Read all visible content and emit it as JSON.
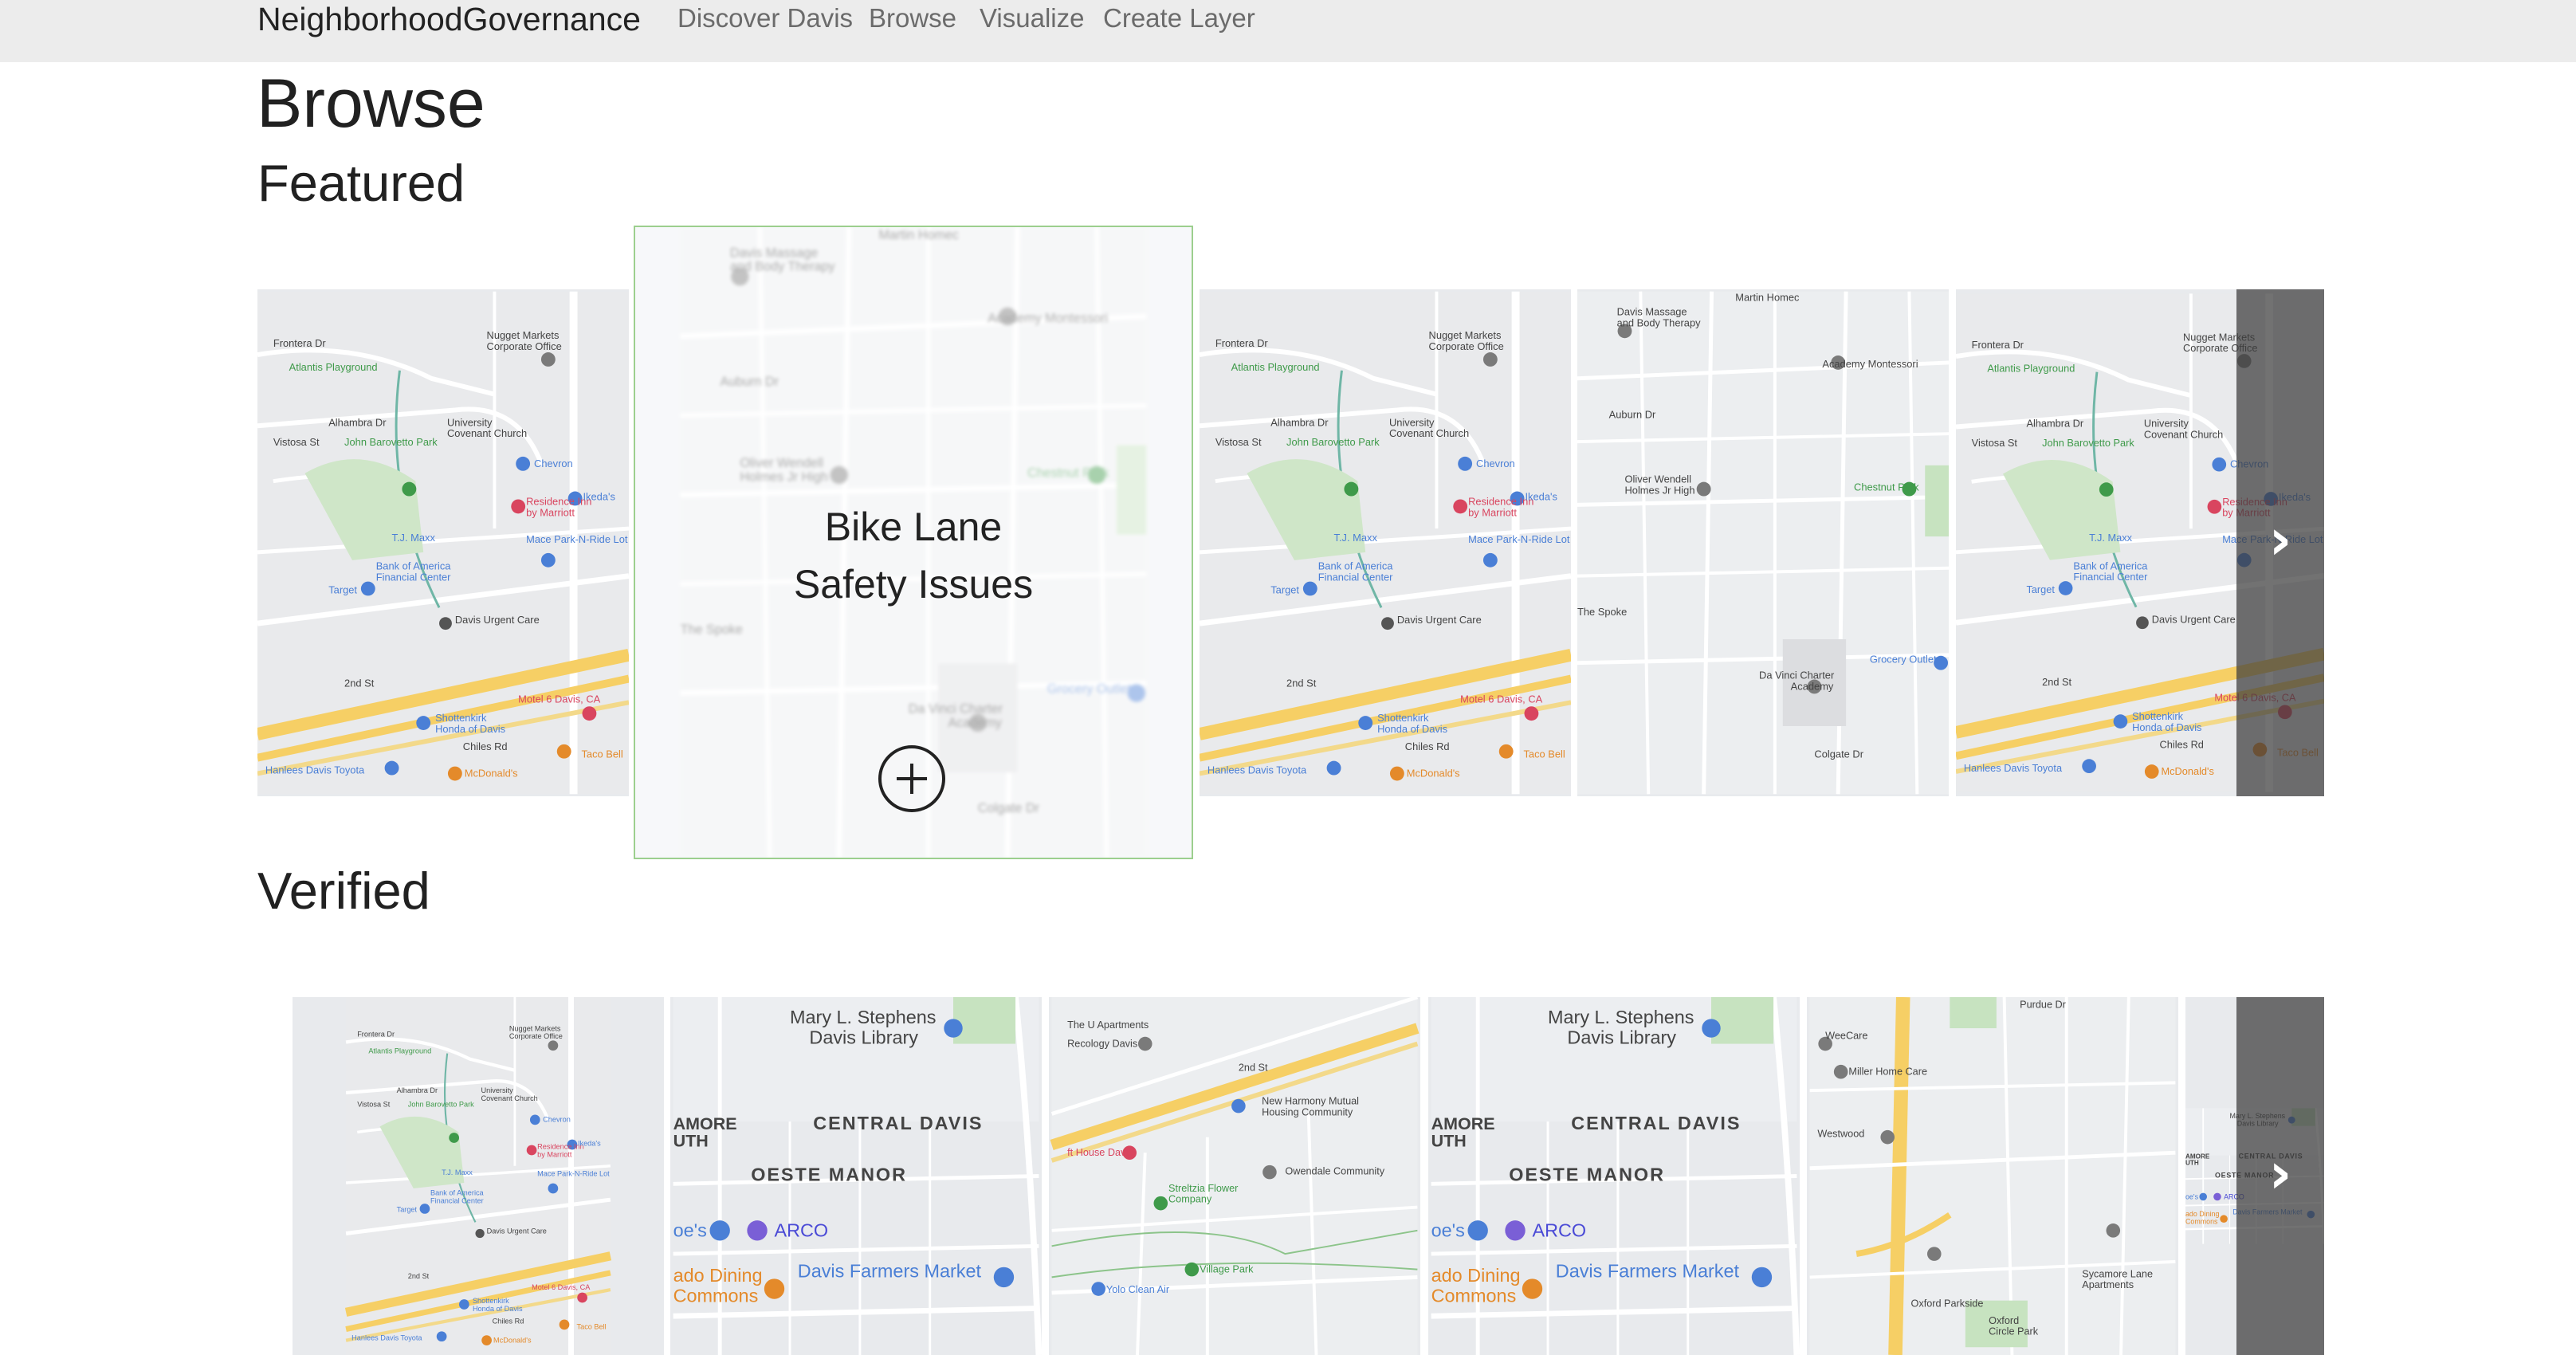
{
  "nav": {
    "brand": "NeighborhoodGovernance",
    "links": [
      "Discover Davis",
      "Browse",
      "Visualize",
      "Create Layer"
    ]
  },
  "page": {
    "title": "Browse",
    "featured_heading": "Featured",
    "verified_heading": "Verified"
  },
  "featured": {
    "hover_title_line1": "Bike Lane",
    "hover_title_line2": "Safety Issues"
  },
  "maps": {
    "north": {
      "labels": [
        "Frontera Dr",
        "Nugget Markets Corporate Office",
        "Atlantis Playground",
        "Alhambra Dr",
        "University Covenant Church",
        "Vistosa St",
        "John Barovetto Park",
        "Chevron",
        "Residence Inn by Marriott",
        "Ikeda's",
        "T.J. Maxx",
        "Mace Park-N-Ride Lot",
        "Bank of America Financial Center",
        "Target",
        "Davis Urgent Care",
        "2nd St",
        "Shottenkirk Honda of Davis",
        "Motel 6 Davis, CA",
        "Chiles Rd",
        "Taco Bell",
        "McDonald's",
        "Hanlees Davis Toyota"
      ]
    },
    "east": {
      "labels": [
        "Martin Homec",
        "Davis Massage and Body Therapy",
        "Academy Montessori",
        "Auburn Dr",
        "Oliver Wendell Holmes Jr High",
        "Chestnut Park",
        "The Spoke",
        "Grocery Outlet",
        "Da Vinci Charter Academy",
        "Colgate Dr"
      ]
    },
    "central": {
      "labels": [
        "Mary L. Stephens Davis Library",
        "CENTRAL DAVIS",
        "OESTE MANOR",
        "ARCO",
        "Davis Farmers Market",
        "ado Dining Commons"
      ]
    },
    "campus": {
      "labels": [
        "2nd St",
        "New Harmony Mutual Housing Community",
        "Owendale Community",
        "Streltzia Flower Company",
        "Village Park",
        "Yolo Clean Air"
      ]
    },
    "south": {
      "labels": [
        "Purdue Dr",
        "WeeCare",
        "Miller Home Care",
        "Westwood",
        "Oxford Parkside",
        "Sycamore Lane Apartments",
        "Oxford Circle Park"
      ]
    }
  },
  "colors": {
    "navbar": "#ececec",
    "map_bg": "#e8eaed",
    "road": "#ffffff",
    "highway": "#f6cf65",
    "park": "#c7e3c0",
    "arrow_panel": "#3c3c3c"
  },
  "icons": {
    "next": "chevron-right-icon",
    "add": "plus-circle-icon"
  },
  "arrow_glyph": "›"
}
